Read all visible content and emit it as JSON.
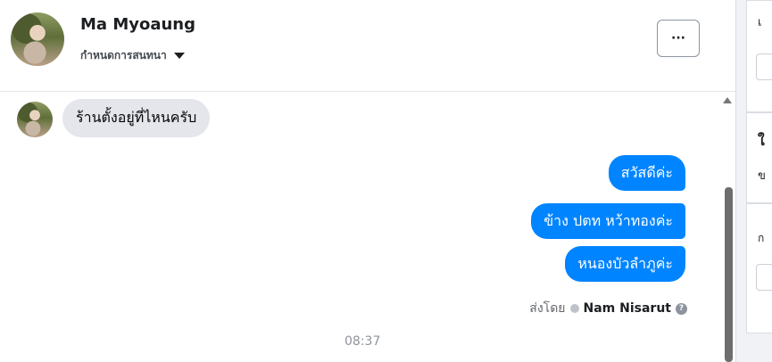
{
  "header": {
    "contact_name": "Ma Myoaung",
    "status_label": "กำหนดการสนทนา",
    "more_label": "···"
  },
  "messages": {
    "incoming": [
      "ร้านตั้งอยู่ที่ไหนครับ"
    ],
    "outgoing": [
      "สวัสดีค่ะ",
      "ข้าง ปตท หว้าทองค่ะ",
      "หนองบัวลำภูค่ะ"
    ],
    "sent_by_prefix": "ส่งโดย",
    "sent_by_name": "Nam Nisarut",
    "help_glyph": "?",
    "timestamp": "08:37"
  },
  "sidebar": {
    "fragments": [
      "เ",
      "ใ",
      "ข",
      "ก"
    ]
  },
  "colors": {
    "outgoing_bubble": "#0084ff",
    "incoming_bubble": "#e4e6eb"
  }
}
